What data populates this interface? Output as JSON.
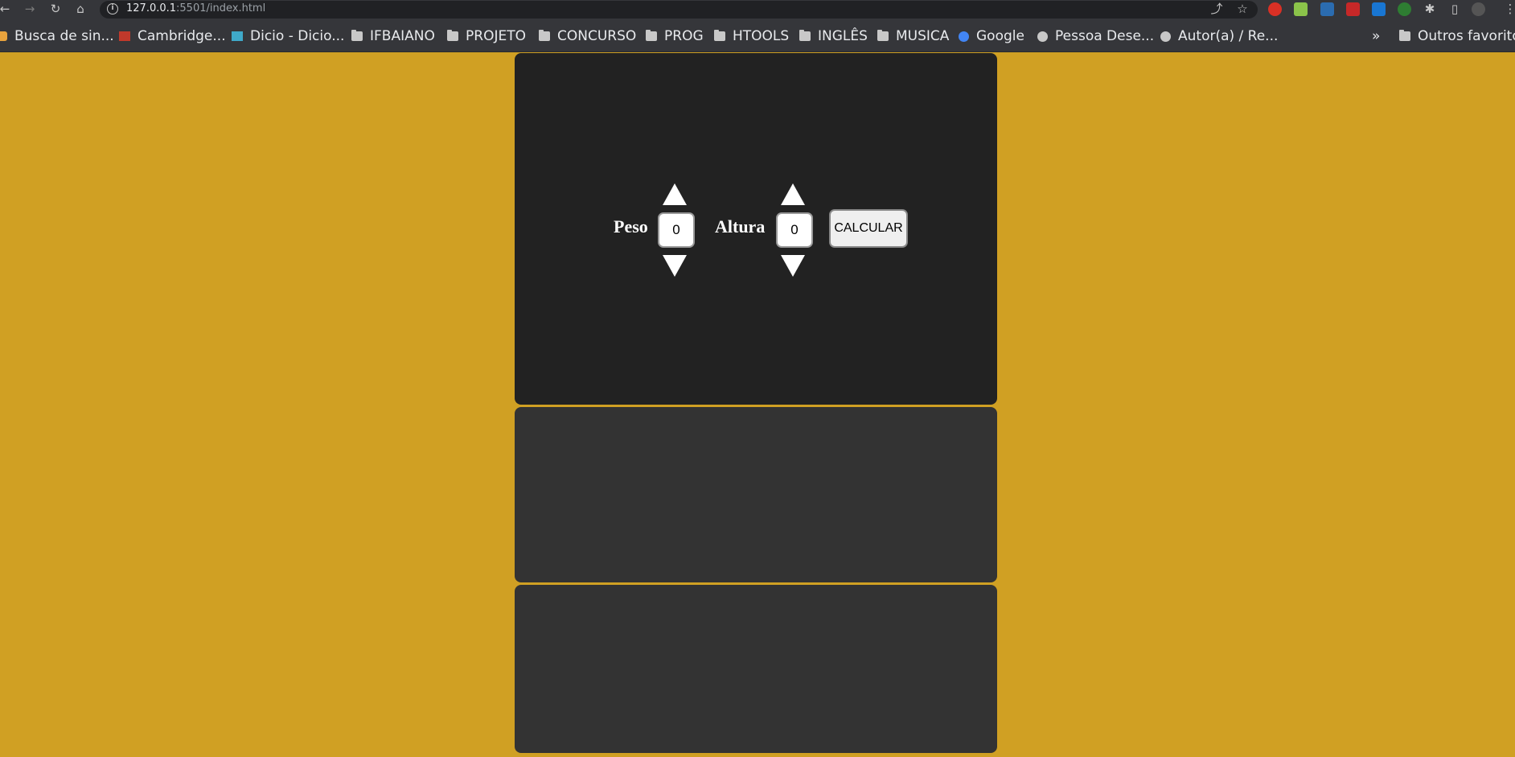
{
  "browser": {
    "url_host": "127.0.0.1",
    "url_rest": ":5501/index.html",
    "bookmarks": [
      {
        "label": "Busca de sin...",
        "icon": "bookmark-icon"
      },
      {
        "label": "Cambridge...",
        "icon": "cambridge-icon"
      },
      {
        "label": "Dicio - Dicio...",
        "icon": "dicio-icon"
      },
      {
        "label": "IFBAIANO",
        "icon": "folder-icon"
      },
      {
        "label": "PROJETO",
        "icon": "folder-icon"
      },
      {
        "label": "CONCURSO",
        "icon": "folder-icon"
      },
      {
        "label": "PROG",
        "icon": "folder-icon"
      },
      {
        "label": "HTOOLS",
        "icon": "folder-icon"
      },
      {
        "label": "INGLÊS",
        "icon": "folder-icon"
      },
      {
        "label": "MUSICA",
        "icon": "folder-icon"
      },
      {
        "label": "Google",
        "icon": "google-icon"
      },
      {
        "label": "Pessoa Dese...",
        "icon": "globe-icon"
      },
      {
        "label": "Autor(a) / Re...",
        "icon": "globe-icon"
      }
    ],
    "overflow": "»",
    "other_bookmarks": "Outros favoritos"
  },
  "calculator": {
    "peso_label": "Peso",
    "peso_value": "0",
    "altura_label": "Altura",
    "altura_value": "0",
    "calc_button": "CALCULAR"
  },
  "colors": {
    "page_bg": "#d0a023",
    "card_main": "#222222",
    "card_secondary": "#333333"
  }
}
